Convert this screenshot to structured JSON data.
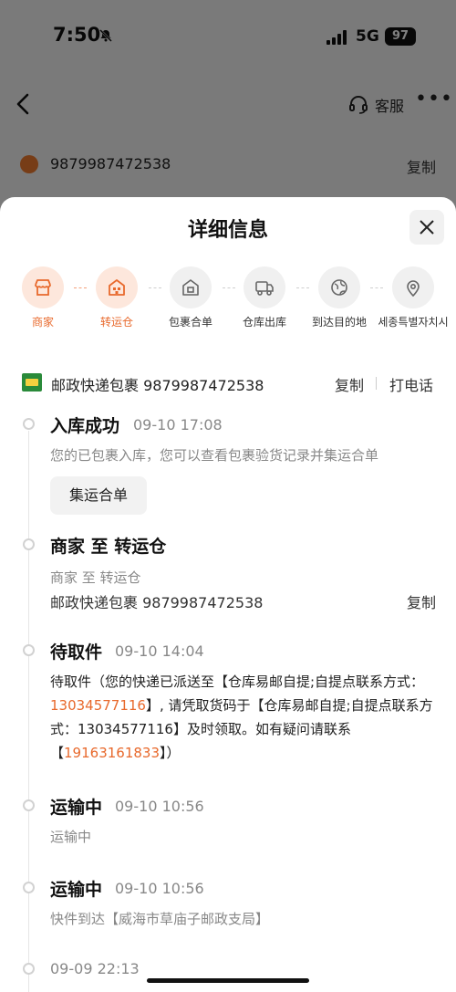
{
  "status_bar": {
    "time": "7:50",
    "network": "5G",
    "battery": "97"
  },
  "nav": {
    "service_label": "客服"
  },
  "background_tracking": {
    "number": "9879987472538",
    "copy_label": "复制"
  },
  "sheet": {
    "title": "详细信息",
    "steps": [
      {
        "label": "商家",
        "icon": "store-icon",
        "active": true
      },
      {
        "label": "转运仓",
        "icon": "warehouse-icon",
        "active": true
      },
      {
        "label": "包裹合单",
        "icon": "merge-package-icon",
        "active": false
      },
      {
        "label": "仓库出库",
        "icon": "truck-icon",
        "active": false
      },
      {
        "label": "到达目的地",
        "icon": "globe-icon",
        "active": false
      },
      {
        "label": "세종특별자치시",
        "icon": "location-pin-icon",
        "active": false
      }
    ],
    "carrier": {
      "text": "邮政快递包裹 9879987472538",
      "copy_label": "复制",
      "call_label": "打电话"
    },
    "timeline": {
      "e1": {
        "title": "入库成功",
        "time": "09-10 17:08",
        "desc": "您的已包裹入库，您可以查看包裹验货记录并集运合单",
        "button_label": "集运合单"
      },
      "e2": {
        "title": "商家 至 转运仓",
        "desc": "商家 至 转运仓",
        "parcel": "邮政快递包裹 9879987472538",
        "copy_label": "复制"
      },
      "e3": {
        "title": "待取件",
        "time": "09-10 14:04",
        "msg_part1": "待取件（您的快递已派送至【仓库易邮自提;自提点联系方式：",
        "msg_phone1": "13034577116",
        "msg_part2": "】, 请凭取货码于【仓库易邮自提;自提点联系方式：13034577116】及时领取。如有疑问请联系【",
        "msg_phone2": "19163161833",
        "msg_part3": "】）"
      },
      "e4": {
        "title": "运输中",
        "time": "09-10 10:56",
        "desc": "运输中"
      },
      "e5": {
        "title": "运输中",
        "time": "09-10 10:56",
        "desc": "快件到达【威海市草庙子邮政支局】"
      },
      "e6": {
        "time": "09-09 22:13"
      }
    }
  },
  "colors": {
    "accent": "#e8692c",
    "accent_bg": "#fde7dc"
  }
}
